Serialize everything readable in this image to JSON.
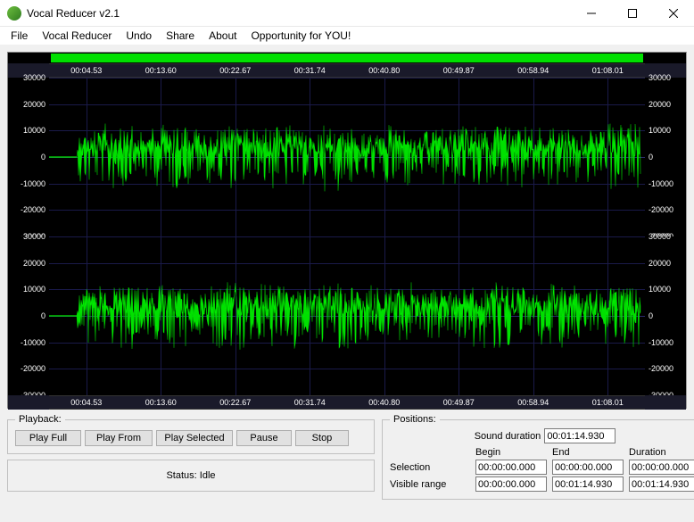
{
  "window": {
    "title": "Vocal Reducer v2.1"
  },
  "menu": {
    "file": "File",
    "vocal_reducer": "Vocal Reducer",
    "undo": "Undo",
    "share": "Share",
    "about": "About",
    "opportunity": "Opportunity for YOU!"
  },
  "ruler": {
    "ticks": [
      "00:04.53",
      "00:13.60",
      "00:22.67",
      "00:31.74",
      "00:40.80",
      "00:49.87",
      "00:58.94",
      "01:08.01"
    ]
  },
  "y_axis": {
    "ticks": [
      "30000",
      "20000",
      "10000",
      "0",
      "-10000",
      "-20000",
      "-30000"
    ]
  },
  "playback": {
    "legend": "Playback:",
    "play_full": "Play Full",
    "play_from": "Play From",
    "play_selected": "Play Selected",
    "pause": "Pause",
    "stop": "Stop"
  },
  "status": {
    "text": "Status: Idle"
  },
  "positions": {
    "legend": "Positions:",
    "sound_duration_label": "Sound duration",
    "sound_duration": "00:01:14.930",
    "begin_hdr": "Begin",
    "end_hdr": "End",
    "duration_hdr": "Duration",
    "selection_label": "Selection",
    "selection_begin": "00:00:00.000",
    "selection_end": "00:00:00.000",
    "selection_duration": "00:00:00.000",
    "visible_label": "Visible range",
    "visible_begin": "00:00:00.000",
    "visible_end": "00:01:14.930",
    "visible_duration": "00:01:14.930"
  },
  "chart_data": [
    {
      "type": "line",
      "channel": "left",
      "ylim": [
        -30000,
        30000
      ],
      "yticks": [
        -30000,
        -20000,
        -10000,
        0,
        10000,
        20000,
        30000
      ],
      "x_unit": "seconds",
      "x_range": [
        0,
        74.93
      ],
      "x_tick_labels": [
        "00:04.53",
        "00:13.60",
        "00:22.67",
        "00:31.74",
        "00:40.80",
        "00:49.87",
        "00:58.94",
        "01:08.01"
      ],
      "approx_peak_amplitude": 13000,
      "approx_rms_amplitude": 4500,
      "silent_lead_in_seconds": 3.5
    },
    {
      "type": "line",
      "channel": "right",
      "ylim": [
        -30000,
        30000
      ],
      "yticks": [
        -30000,
        -20000,
        -10000,
        0,
        10000,
        20000,
        30000
      ],
      "x_unit": "seconds",
      "x_range": [
        0,
        74.93
      ],
      "x_tick_labels": [
        "00:04.53",
        "00:13.60",
        "00:22.67",
        "00:31.74",
        "00:40.80",
        "00:49.87",
        "00:58.94",
        "01:08.01"
      ],
      "approx_peak_amplitude": 13000,
      "approx_rms_amplitude": 4500,
      "silent_lead_in_seconds": 3.5
    }
  ]
}
